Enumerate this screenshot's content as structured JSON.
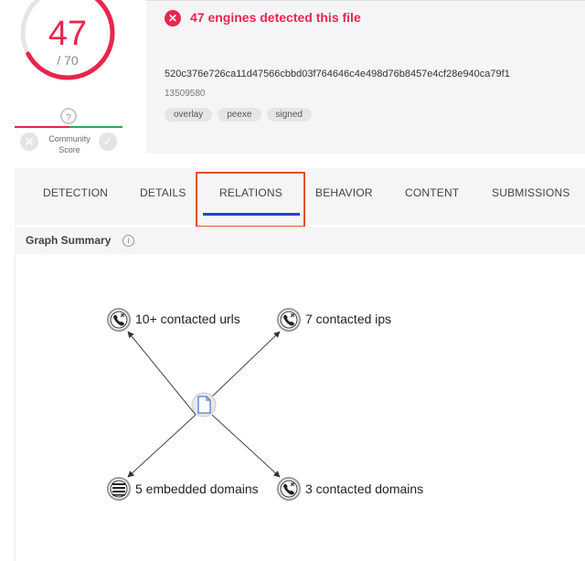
{
  "score": {
    "detected": "47",
    "total": "/ 70",
    "fraction": 0.671,
    "color": "#e8254e"
  },
  "community": {
    "question": "?",
    "label_line1": "Community",
    "label_line2": "Score"
  },
  "file": {
    "alert": "47 engines detected this file",
    "hash": "520c376e726ca11d47566cbbd03f764646c4e498d76b8457e4cf28e940ca79f1",
    "size": "13509580",
    "tags": [
      "overlay",
      "peexe",
      "signed"
    ]
  },
  "tabs": [
    {
      "label": "DETECTION"
    },
    {
      "label": "DETAILS"
    },
    {
      "label": "RELATIONS",
      "active": true
    },
    {
      "label": "BEHAVIOR"
    },
    {
      "label": "CONTENT"
    },
    {
      "label": "SUBMISSIONS"
    }
  ],
  "graph": {
    "title": "Graph Summary",
    "info": "i",
    "nodes": [
      {
        "label": "10+ contacted urls",
        "icon": "phone-icon"
      },
      {
        "label": "7 contacted ips",
        "icon": "phone-icon"
      },
      {
        "label": "5 embedded domains",
        "icon": "list-icon"
      },
      {
        "label": "3 contacted domains",
        "icon": "phone-icon"
      }
    ],
    "center_icon": "file-icon"
  }
}
